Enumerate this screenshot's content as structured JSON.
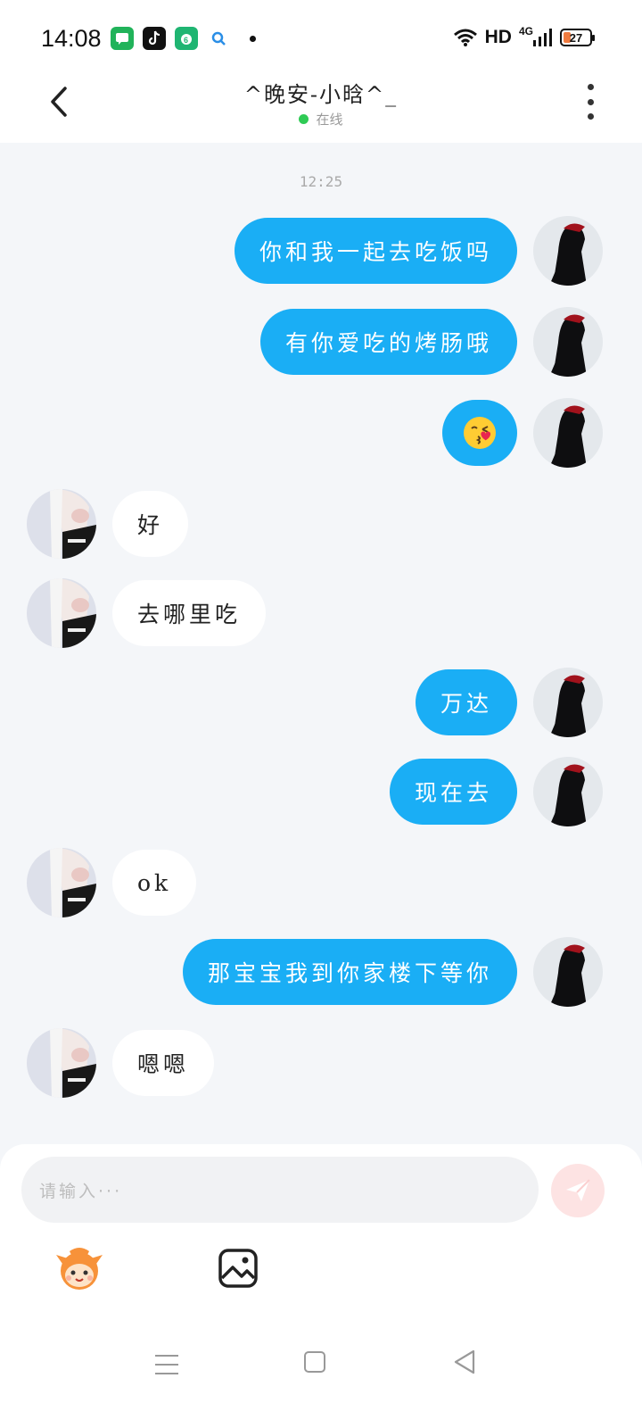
{
  "status_bar": {
    "time": "14:08",
    "network": "HD",
    "signal_type": "4G",
    "battery": "27"
  },
  "header": {
    "title": "^晚安-小晗^_",
    "status": "在线"
  },
  "chat": {
    "timestamp": "12:25",
    "messages": [
      {
        "side": "right",
        "text": "你和我一起去吃饭吗"
      },
      {
        "side": "right",
        "text": "有你爱吃的烤肠哦"
      },
      {
        "side": "right",
        "text": "😘"
      },
      {
        "side": "left",
        "text": "好"
      },
      {
        "side": "left",
        "text": "去哪里吃"
      },
      {
        "side": "right",
        "text": "万达"
      },
      {
        "side": "right",
        "text": "现在去"
      },
      {
        "side": "left",
        "text": "ok"
      },
      {
        "side": "right",
        "text": "那宝宝我到你家楼下等你"
      },
      {
        "side": "left",
        "text": "嗯嗯"
      }
    ]
  },
  "composer": {
    "placeholder": "请输入···"
  },
  "icons": {
    "back": "back-arrow-icon",
    "more": "more-vertical-icon",
    "send": "send-icon",
    "mascot": "mascot-sticker-icon",
    "image": "image-icon"
  },
  "colors": {
    "accent": "#1aaef5",
    "online": "#2fcb55",
    "chat_bg": "#f4f6f9",
    "send_bg": "#fde3e3"
  }
}
